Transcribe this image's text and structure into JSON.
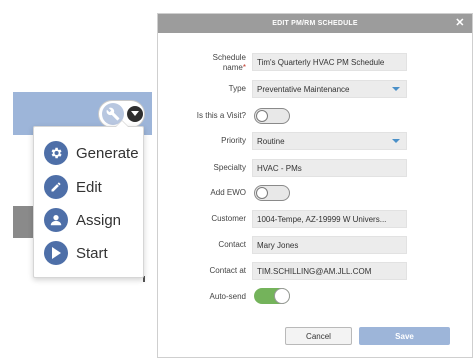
{
  "menu": {
    "items": [
      {
        "label": "Generate",
        "icon": "gear-icon"
      },
      {
        "label": "Edit",
        "icon": "pencil-icon"
      },
      {
        "label": "Assign",
        "icon": "user-icon"
      },
      {
        "label": "Start",
        "icon": "play-icon"
      }
    ]
  },
  "modal": {
    "title": "EDIT PM/RM SCHEDULE",
    "fields": {
      "schedule_name": {
        "label_line1": "Schedule",
        "label_line2": "name",
        "required_mark": "*",
        "value": "Tim's Quarterly HVAC PM Schedule"
      },
      "type": {
        "label": "Type",
        "value": "Preventative Maintenance"
      },
      "is_visit": {
        "label": "Is this a Visit?",
        "on": false
      },
      "priority": {
        "label": "Priority",
        "value": "Routine"
      },
      "specialty": {
        "label": "Specialty",
        "value": "HVAC - PMs"
      },
      "add_ewo": {
        "label": "Add EWO",
        "on": false
      },
      "customer": {
        "label": "Customer",
        "value": "1004-Tempe, AZ-19999 W Univers..."
      },
      "contact": {
        "label": "Contact",
        "value": "Mary Jones"
      },
      "contact_at": {
        "label": "Contact at",
        "value": "TIM.SCHILLING@AM.JLL.COM"
      },
      "auto_send": {
        "label": "Auto-send",
        "on": true
      }
    },
    "buttons": {
      "cancel": "Cancel",
      "save": "Save"
    }
  },
  "colors": {
    "accent": "#9db5d9",
    "menu_icon": "#4e6fa8",
    "header": "#9c9c9c",
    "toggle_on": "#74b35b",
    "select_caret": "#4a90c8"
  }
}
